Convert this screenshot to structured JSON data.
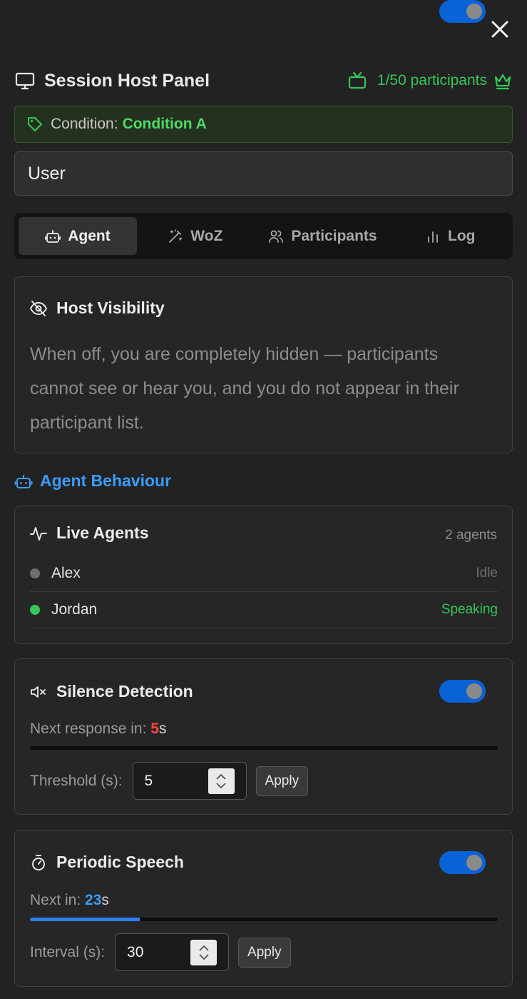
{
  "header": {
    "title": "Session Host Panel",
    "participants": "1/50 participants",
    "close_icon": "close-icon",
    "accent": "#34c759"
  },
  "condition": {
    "label": "Condition:",
    "value": "Condition A"
  },
  "user_field": {
    "value": "User"
  },
  "tabs": [
    {
      "label": "Agent",
      "icon": "robot-icon",
      "active": true
    },
    {
      "label": "WoZ",
      "icon": "magic-wand-icon",
      "active": false
    },
    {
      "label": "Participants",
      "icon": "users-icon",
      "active": false
    },
    {
      "label": "Log",
      "icon": "bar-chart-icon",
      "active": false
    }
  ],
  "host_visibility": {
    "title": "Host Visibility",
    "enabled": true,
    "description": "When off, you are completely hidden — participants cannot see or hear you, and you do not appear in their participant list."
  },
  "agent_behaviour": {
    "title": "Agent Behaviour",
    "color": "#3b9cff"
  },
  "live_agents": {
    "title": "Live Agents",
    "count": "2 agents",
    "agents": [
      {
        "name": "Alex",
        "status": "Idle",
        "dot_color": "#6e6e6e",
        "status_color": "#6e6e6e"
      },
      {
        "name": "Jordan",
        "status": "Speaking",
        "dot_color": "#34c759",
        "status_color": "#34c759"
      }
    ]
  },
  "silence_detection": {
    "title": "Silence Detection",
    "enabled": true,
    "next_label": "Next response in:",
    "next_value": "5",
    "next_unit": "s",
    "progress": 0.0,
    "threshold_label": "Threshold (s):",
    "threshold_value": "5",
    "apply_label": "Apply"
  },
  "periodic_speech": {
    "title": "Periodic Speech",
    "enabled": true,
    "next_label": "Next in:",
    "next_value": "23",
    "next_unit": "s",
    "progress": 0.235,
    "interval_label": "Interval (s):",
    "interval_value": "30",
    "apply_label": "Apply"
  }
}
